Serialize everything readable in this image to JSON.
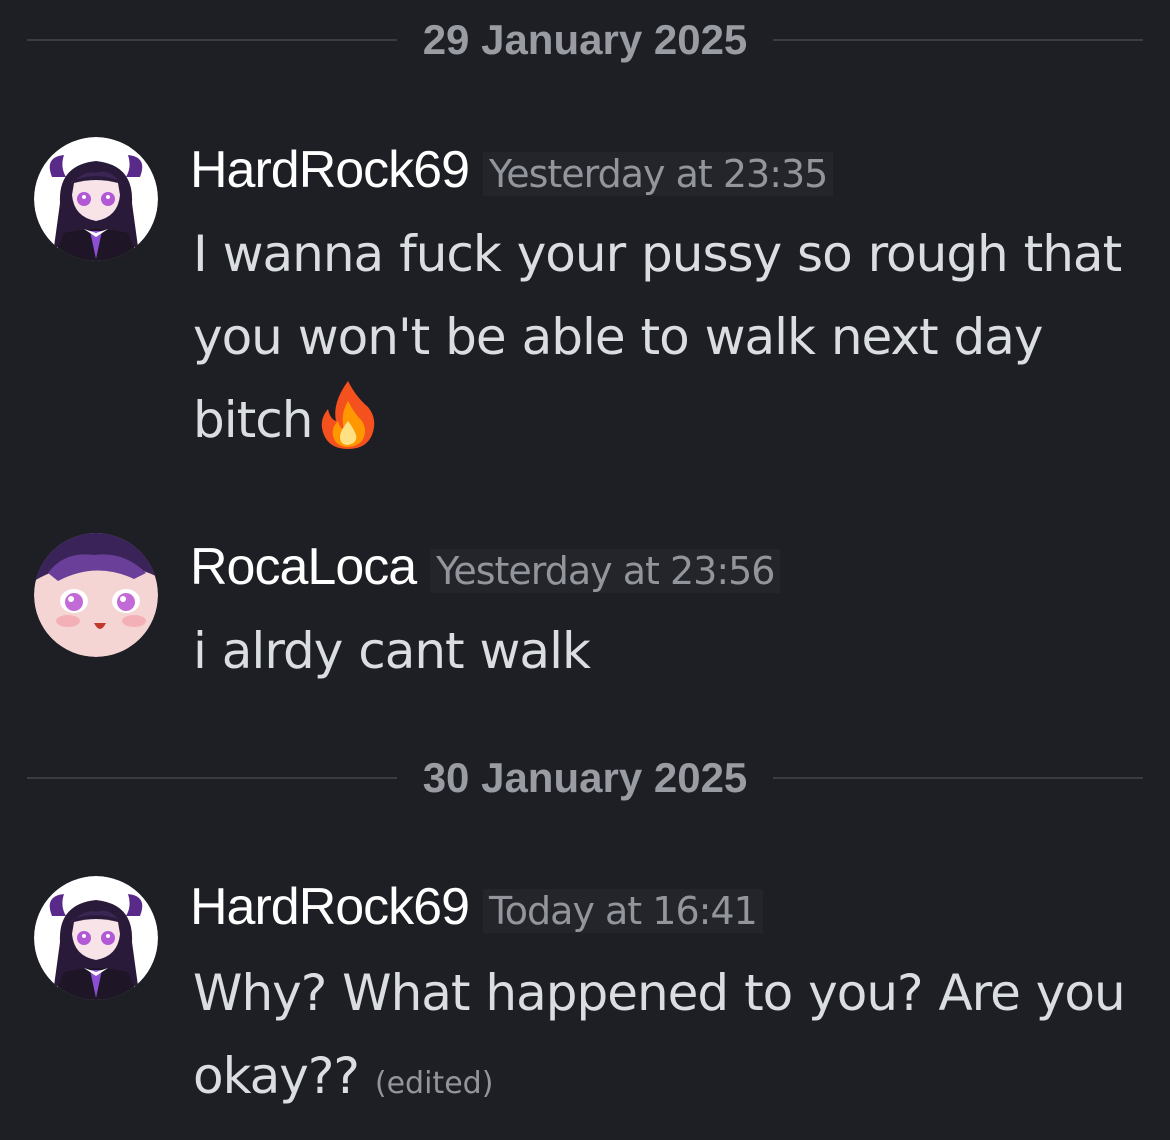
{
  "dividers": [
    {
      "label": "29 January 2025"
    },
    {
      "label": "30 January 2025"
    }
  ],
  "messages": [
    {
      "username": "HardRock69",
      "timestamp": "Yesterday at 23:35",
      "text": "I wanna fuck your pussy so rough that you won't be able to walk next day bitch",
      "emoji": "fire-icon",
      "avatar": "purple-anime-avatar"
    },
    {
      "username": "RocaLoca",
      "timestamp": "Yesterday at 23:56",
      "text": "i alrdy cant walk",
      "avatar": "pink-anime-avatar"
    },
    {
      "username": "HardRock69",
      "timestamp": "Today at 16:41",
      "text": "Why? What happened to you? Are you okay??",
      "edited_label": "(edited)",
      "avatar": "purple-anime-avatar"
    }
  ],
  "colors": {
    "background": "#1e1f24",
    "username": "#ffffff",
    "message_text": "#dbdee1",
    "muted": "#92959c",
    "divider": "#3a3c42"
  }
}
